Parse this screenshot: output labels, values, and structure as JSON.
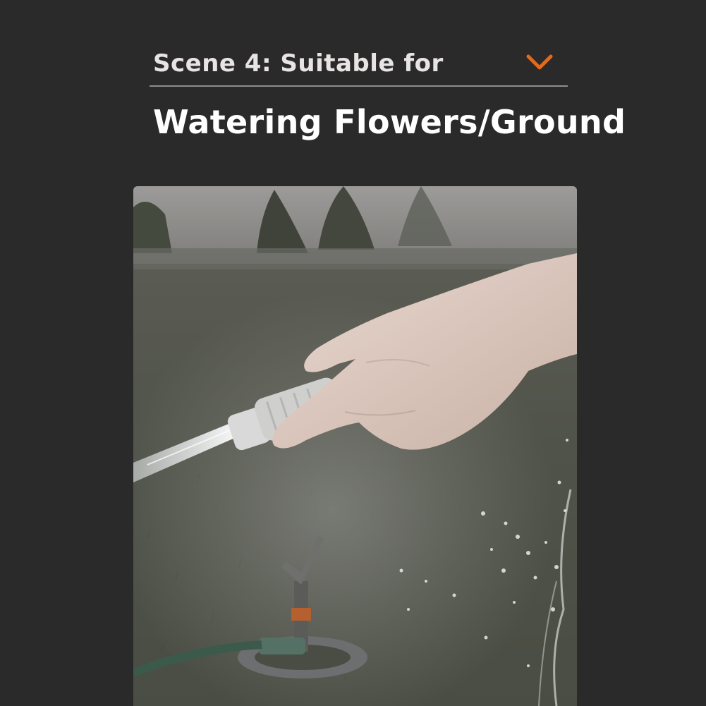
{
  "header": {
    "subtitle": "Scene 4: Suitable for",
    "title": "Watering Flowers/Ground",
    "chevron_icon": "chevron-down-icon"
  },
  "colors": {
    "background": "#2b2a2b",
    "accent": "#e06b1f",
    "text": "#ffffff"
  }
}
